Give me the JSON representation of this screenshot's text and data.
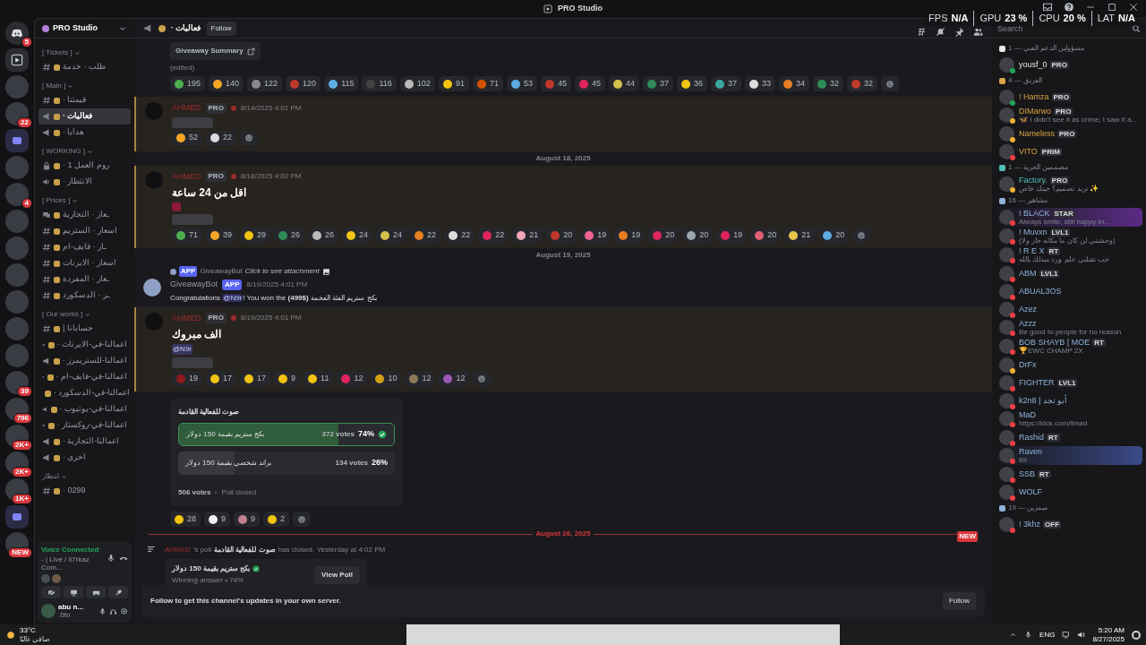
{
  "window": {
    "title": "PRO Studio"
  },
  "stats": [
    {
      "label": "FPS",
      "value": "N/A"
    },
    {
      "label": "GPU",
      "value": "23 %"
    },
    {
      "label": "CPU",
      "value": "20 %"
    },
    {
      "label": "LAT",
      "value": "N/A"
    }
  ],
  "rail": [
    {
      "kind": "home",
      "badge": "5"
    },
    {
      "kind": "stream"
    },
    {
      "kind": "server"
    },
    {
      "kind": "server",
      "badge": "22"
    },
    {
      "kind": "folder"
    },
    {
      "kind": "server"
    },
    {
      "kind": "server",
      "badge": "4"
    },
    {
      "kind": "server"
    },
    {
      "kind": "server"
    },
    {
      "kind": "server"
    },
    {
      "kind": "server"
    },
    {
      "kind": "server"
    },
    {
      "kind": "server"
    },
    {
      "kind": "server",
      "badge": "39"
    },
    {
      "kind": "server",
      "badge": "796"
    },
    {
      "kind": "server",
      "badge": "2K+"
    },
    {
      "kind": "server",
      "badge": "2K+"
    },
    {
      "kind": "server",
      "badge": "1K+"
    },
    {
      "kind": "folder"
    },
    {
      "kind": "server",
      "badge": "NEW"
    }
  ],
  "server": {
    "name": "PRO Studio"
  },
  "categories": [
    {
      "name": "[ Tickets ]",
      "channels": [
        {
          "name": "طلب · خدمة",
          "kind": "text",
          "selected": false
        }
      ]
    },
    {
      "name": "[ Main ]",
      "channels": [
        {
          "name": "قيمتنا ·",
          "kind": "text",
          "selected": false
        },
        {
          "name": "فعاليات ·",
          "kind": "announcement",
          "selected": true
        },
        {
          "name": "هدايا ·",
          "kind": "announcement",
          "selected": false
        }
      ]
    },
    {
      "name": "[ WORKING ]",
      "channels": [
        {
          "name": "روم العمل 1 ·",
          "kind": "locked",
          "selected": false
        },
        {
          "name": "الانتظار ·",
          "kind": "voice",
          "selected": false
        }
      ]
    },
    {
      "name": "[ Prices ]",
      "channels": [
        {
          "name": "ـعار · التجارية",
          "kind": "forum",
          "selected": false
        },
        {
          "name": "اسعار · الستريم",
          "kind": "text",
          "selected": false
        },
        {
          "name": "ـار · فايف-ام",
          "kind": "text",
          "selected": false
        },
        {
          "name": "اسعار · الايرنات",
          "kind": "text",
          "selected": false
        },
        {
          "name": "ـعار · المفردة",
          "kind": "text",
          "selected": false
        },
        {
          "name": "ـر · الدسكورد",
          "kind": "text",
          "selected": false
        }
      ]
    },
    {
      "name": "[ Our works ]",
      "channels": [
        {
          "name": "حسابانا |",
          "kind": "text",
          "selected": false
        },
        {
          "name": "اعمالنا-في-الايرنات ·",
          "kind": "announcement",
          "selected": false
        },
        {
          "name": "اعمالنا-للستريمرز ·",
          "kind": "announcement",
          "selected": false
        },
        {
          "name": "اعمالنا-في-فايف-ام ·",
          "kind": "announcement",
          "selected": false
        },
        {
          "name": "اعمالنا-في-الدسكورد ·",
          "kind": "announcement",
          "selected": false
        },
        {
          "name": "اعمالنا-في-يوتيوب ·",
          "kind": "announcement",
          "selected": false
        },
        {
          "name": "اعمالنا-في-روكستار ·",
          "kind": "announcement",
          "selected": false
        },
        {
          "name": "اعمالنا-التجارية ·",
          "kind": "announcement",
          "selected": false
        },
        {
          "name": "اخرى ·",
          "kind": "announcement",
          "selected": false
        }
      ]
    },
    {
      "name": "انتظار",
      "channels": [
        {
          "name": "0299 ·",
          "kind": "text",
          "selected": false
        }
      ]
    }
  ],
  "voice": {
    "status": "Voice Connected",
    "channel": "- | Live / il7rkaz Com..."
  },
  "user": {
    "name": "abu n...",
    "status": ".0fn"
  },
  "channel": {
    "name": "فعاليات ·",
    "follow": "Follow"
  },
  "messages": [
    {
      "kind": "continuation",
      "button": "Giveaway Summary",
      "edited": "(edited)",
      "reactions": [
        {
          "count": "195",
          "color": "#4caf50"
        },
        {
          "count": "140",
          "color": "#f5a623"
        },
        {
          "count": "122",
          "color": "#888888"
        },
        {
          "count": "120",
          "color": "#c0392b"
        },
        {
          "count": "115",
          "color": "#5dade2"
        },
        {
          "count": "116",
          "color": "#444444"
        },
        {
          "count": "102",
          "color": "#bbbbbb"
        },
        {
          "count": "91",
          "color": "#f1c40f"
        },
        {
          "count": "71",
          "color": "#d35400"
        },
        {
          "count": "53",
          "color": "#5dade2"
        },
        {
          "count": "45",
          "color": "#c0392b"
        },
        {
          "count": "45",
          "color": "#e0245e"
        },
        {
          "count": "44",
          "color": "#d4c24a"
        },
        {
          "count": "37",
          "color": "#2e8b57"
        },
        {
          "count": "36",
          "color": "#f1c40f"
        },
        {
          "count": "37",
          "color": "#3aa8a0"
        },
        {
          "count": "33",
          "color": "#dddddd"
        },
        {
          "count": "34",
          "color": "#e67e22"
        },
        {
          "count": "32",
          "color": "#2e8b57"
        },
        {
          "count": "32",
          "color": "#c0392b"
        }
      ]
    },
    {
      "kind": "message",
      "author": "AHMED",
      "badge": "PRO",
      "time": "8/14/2025 4:01 PM",
      "highlighted": true,
      "redacted": true,
      "reactions": [
        {
          "count": "52",
          "color": "#f5a623"
        },
        {
          "count": "22",
          "color": "#dddddd"
        }
      ]
    },
    {
      "kind": "date",
      "text": "August 18, 2025"
    },
    {
      "kind": "message",
      "author": "AHMED",
      "badge": "PRO",
      "time": "8/18/2025 4:02 PM",
      "highlighted": true,
      "text": "اقل من 24 ساعة",
      "sticker": true,
      "redacted": true,
      "reactions": [
        {
          "count": "71",
          "color": "#4caf50"
        },
        {
          "count": "39",
          "color": "#f5a623"
        },
        {
          "count": "29",
          "color": "#f1c40f"
        },
        {
          "count": "26",
          "color": "#2e8b57"
        },
        {
          "count": "26",
          "color": "#bbbbbb"
        },
        {
          "count": "24",
          "color": "#f1c40f"
        },
        {
          "count": "24",
          "color": "#d4c24a"
        },
        {
          "count": "22",
          "color": "#e67e22"
        },
        {
          "count": "22",
          "color": "#dddddd"
        },
        {
          "count": "22",
          "color": "#e0245e"
        },
        {
          "count": "21",
          "color": "#f4a6b8"
        },
        {
          "count": "20",
          "color": "#c0392b"
        },
        {
          "count": "19",
          "color": "#f06292"
        },
        {
          "count": "19",
          "color": "#e67e22"
        },
        {
          "count": "20",
          "color": "#e0245e"
        },
        {
          "count": "20",
          "color": "#9aa7b0"
        },
        {
          "count": "19",
          "color": "#e0245e"
        },
        {
          "count": "20",
          "color": "#e06070"
        },
        {
          "count": "21",
          "color": "#e6c74a"
        },
        {
          "count": "20",
          "color": "#5dade2"
        }
      ]
    },
    {
      "kind": "date",
      "text": "August 19, 2025"
    },
    {
      "kind": "bot",
      "reply": {
        "badge": "APP",
        "author": "GiveawayBot",
        "text": "Click to see attachment"
      },
      "author": "GiveawayBot",
      "badge": "APP",
      "time": "8/19/2025 4:01 PM",
      "text_before": "Congratulations",
      "mention": "@N9r",
      "text_after": "! You won the **(499$)** بكج ستريم الفئة الفخمة"
    },
    {
      "kind": "message",
      "author": "AHMED",
      "badge": "PRO",
      "time": "8/19/2025 4:01 PM",
      "highlighted": true,
      "text": "الف مبروك",
      "mention": "@N9r",
      "redacted": true,
      "reactions": [
        {
          "count": "19",
          "color": "#8b1a1a"
        },
        {
          "count": "17",
          "color": "#f1c40f"
        },
        {
          "count": "17",
          "color": "#f1c40f"
        },
        {
          "count": "9",
          "color": "#f1c40f"
        },
        {
          "count": "11",
          "color": "#f1c40f"
        },
        {
          "count": "12",
          "color": "#e0245e"
        },
        {
          "count": "10",
          "color": "#d4a017"
        },
        {
          "count": "12",
          "color": "#8d7b5a"
        },
        {
          "count": "12",
          "color": "#9b59b6"
        }
      ],
      "poll": {
        "question": "صوت للفعالية القادمة",
        "options": [
          {
            "text": "بكج ستريم بقيمة 150 دولار",
            "votes": "372 votes",
            "percent": "74%",
            "level": 0.74,
            "selected": true
          },
          {
            "text": "براند شخصي بقيمة 150 دولار",
            "votes": "134 votes",
            "percent": "26%",
            "level": 0.26,
            "selected": false
          }
        ],
        "total": "506 votes",
        "status": "Poll closed"
      },
      "poll_reactions": [
        {
          "count": "28",
          "color": "#f1c40f"
        },
        {
          "count": "9",
          "color": "#eeeeee"
        },
        {
          "count": "9",
          "color": "#c08090"
        },
        {
          "count": "2",
          "color": "#f1c40f"
        }
      ]
    },
    {
      "kind": "date",
      "text": "August 26, 2025",
      "new": "NEW"
    },
    {
      "kind": "poll_result",
      "author": "AHMED",
      "text_a": "'s poll",
      "poll": "صوت للفعالية القادمة",
      "text_b": "has closed.",
      "time": "Yesterday at 4:02 PM",
      "answer": "بكج ستريم بقيمة 150 دولار",
      "detail": "Winning answer • 74%",
      "button": "View Poll"
    }
  ],
  "follow_bar": {
    "text": "Follow to get this channel's updates in your own server.",
    "button": "Follow"
  },
  "search": {
    "placeholder": "Search"
  },
  "member_groups": [
    {
      "title": "مسؤولين الدعم الفني — 1",
      "color": "#e8e8e8",
      "members": [
        {
          "name": "yousf_0",
          "badge": "PRO",
          "kind": "plain",
          "color": "#23a55a"
        }
      ]
    },
    {
      "title": "الفريق — 4",
      "color": "#d9a441",
      "members": [
        {
          "name": "! Hamza",
          "badge": "PRO",
          "kind": "plain",
          "color": "#23a55a"
        },
        {
          "name": "DIMarwo",
          "badge": "PRO",
          "kind": "plain",
          "color": "#f0b232",
          "activity": "🦋 I didn't see it as crime; I saw it a..."
        },
        {
          "name": "Nameless",
          "badge": "PRO",
          "kind": "plain",
          "color": "#f0b232"
        },
        {
          "name": "VITO",
          "badge": "PRIM",
          "kind": "plain",
          "color": "#f23f43"
        }
      ]
    },
    {
      "title": "مصممين الحرية — 1",
      "color": "#4fc1b8",
      "members": [
        {
          "name": "Factory.",
          "badge": "PRO",
          "kind": "plain",
          "color": "#f0b232",
          "activity": "تريد تصميم؟ جيتك خاص ✨"
        }
      ]
    },
    {
      "title": "مشاهير — 16",
      "color": "#8fb3d9",
      "members": [
        {
          "name": "! BLACK",
          "badge": "STAR",
          "kind": "violet",
          "color": "#f23f43",
          "activity": "Always smile, still happy In..."
        },
        {
          "name": "! Muvxn",
          "badge": "LVL1",
          "kind": "plain",
          "color": "#f23f43",
          "activity": "(وحشتني لن كان ما مكانه جار ولا)"
        },
        {
          "name": "! R E X",
          "badge": "RT",
          "kind": "plain",
          "color": "#f23f43",
          "activity": "حب تقتلني علم ورد مبدلك بالله"
        },
        {
          "name": "ABM",
          "badge": "LVL1",
          "kind": "plain",
          "color": "#f23f43"
        },
        {
          "name": "ABUAL3OS",
          "kind": "plain",
          "color": "#f23f43"
        },
        {
          "name": "Azez",
          "kind": "plain",
          "color": "#f23f43"
        },
        {
          "name": "Azzz",
          "kind": "plain",
          "color": "#f23f43",
          "activity": "Be good to people for no reason"
        },
        {
          "name": "BOB SHAYB | MOE",
          "badge": "RT",
          "kind": "plain",
          "color": "#f23f43",
          "activity": "🏆EWC CHAMP 2X"
        },
        {
          "name": "DrFx",
          "kind": "plain",
          "color": "#f0b232"
        },
        {
          "name": "FIGHTER",
          "badge": "LVL1",
          "kind": "plain",
          "color": "#f23f43"
        },
        {
          "name": "k2n8 | أبو نجد",
          "kind": "plain",
          "color": "#f23f43"
        },
        {
          "name": "MaD",
          "kind": "plain",
          "color": "#f23f43",
          "activity": "https://kick.com/llmad"
        },
        {
          "name": "Rashid",
          "badge": "RT",
          "kind": "plain",
          "color": "#f23f43"
        },
        {
          "name": "Raven",
          "kind": "indigo",
          "color": "#f23f43",
          "activity": "89"
        },
        {
          "name": "SSB",
          "badge": "RT",
          "kind": "plain",
          "color": "#f23f43"
        },
        {
          "name": "WOLF",
          "kind": "plain",
          "color": "#f23f43"
        }
      ]
    },
    {
      "title": "ميمزين — 19",
      "color": "#8fb3d9",
      "members": [
        {
          "name": "! 3khz",
          "badge": "OFF",
          "kind": "plain",
          "color": "#f23f43"
        }
      ]
    }
  ],
  "taskbar": {
    "temperature": "33°C",
    "weather": "صافي غالبًا",
    "language": "ENG",
    "time": "5:20 AM",
    "date": "8/27/2025"
  }
}
